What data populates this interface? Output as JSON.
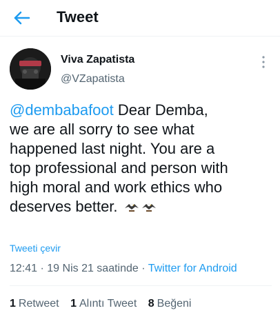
{
  "header": {
    "title": "Tweet",
    "back_icon": "back-arrow-icon"
  },
  "tweet": {
    "author_name": "Viva Zapatista",
    "author_handle": "@VZapatista",
    "mention": "@dembabafoot",
    "text_line1_rest": " Dear Demba,",
    "text_line2": "we are all sorry to see what",
    "text_line3": "happened last night. You are a",
    "text_line4": "top professional and person with",
    "text_line5": "high moral and work ethics who",
    "text_line6": "deserves better.",
    "emoji": [
      "eagle-icon",
      "eagle-icon"
    ],
    "translate_label": "Tweeti çevir",
    "time": "12:41",
    "sep1": " · ",
    "date": "19 Nis 21 saatinde",
    "sep2": " · ",
    "source": "Twitter for Android"
  },
  "stats": {
    "retweets_count": "1",
    "retweets_label": "Retweet",
    "quotes_count": "1",
    "quotes_label": "Alıntı Tweet",
    "likes_count": "8",
    "likes_label": "Beğeni"
  },
  "colors": {
    "accent": "#1d9bf0",
    "text": "#0f1419",
    "secondary": "#536471"
  }
}
